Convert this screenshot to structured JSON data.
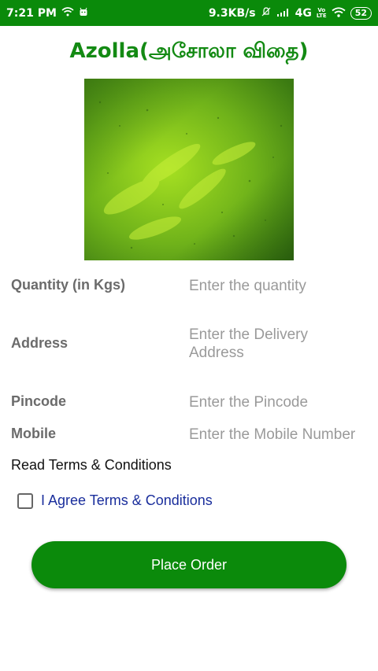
{
  "status_bar": {
    "time": "7:21 PM",
    "network_speed": "9.3KB/s",
    "network_type": "4G",
    "battery": "52",
    "icons": [
      "wifi-icon",
      "android-icon",
      "mute-icon",
      "signal-icon",
      "volte-icon",
      "wifi-icon",
      "battery-icon"
    ]
  },
  "page": {
    "title": "Azolla(அசோலா விதை)"
  },
  "form": {
    "quantity": {
      "label": "Quantity (in Kgs)",
      "placeholder": "Enter the quantity"
    },
    "address": {
      "label": "Address",
      "placeholder": "Enter the Delivery Address"
    },
    "pincode": {
      "label": "Pincode",
      "placeholder": "Enter the Pincode"
    },
    "mobile": {
      "label": "Mobile",
      "placeholder": "Enter the Mobile Number"
    }
  },
  "terms": {
    "link_text": "Read Terms & Conditions",
    "agree_label": "I Agree Terms & Conditions",
    "checked": false
  },
  "actions": {
    "place_order": "Place Order"
  },
  "colors": {
    "accent": "#0a8a0a",
    "agree_text": "#1a2e9c"
  }
}
